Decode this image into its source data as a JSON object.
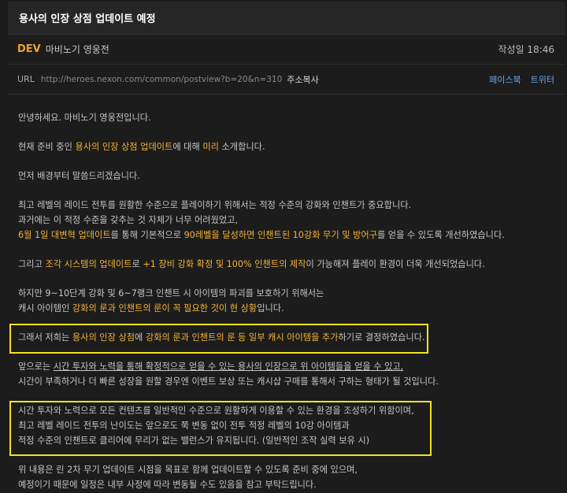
{
  "post": {
    "title": "용사의 인장 상점 업데이트 예정",
    "author_tag": "DEV",
    "author_name": "마비노기 영웅전",
    "date": "작성일 18:46",
    "url_label": "URL",
    "url": "http://heroes.nexon.com/common/postview?b=20&n=310",
    "copy_label": "주소복사",
    "share_facebook": "페이스북",
    "share_twitter": "트위터"
  },
  "body": {
    "p1": "안녕하세요. 마비노기 영웅전입니다.",
    "p2": {
      "a": "현재 준비 중인 ",
      "b": "용사의 인장 상점 업데이트",
      "c": "에 대해 ",
      "d": "미리",
      "e": " 소개합니다."
    },
    "p3": "먼저 배경부터 말씀드리겠습니다.",
    "p4_l1": "최고 레벨의 레이드 전투를 원활한 수준으로 플레이하기 위해서는 적정 수준의 강화와 인챈트가 중요합니다.",
    "p4_l2": "과거에는 이 적정 수준을 갖추는 것 자체가 너무 어려웠었고,",
    "p4_l3": {
      "a": "6월 1일 대변혁 업데이트",
      "b": "를 통해 기본적으로 ",
      "c": "90레벨을 달성하면 인챈트된 10강화 무기 및 방어구",
      "d": "를 얻을 수 있도록 개선하였습니다."
    },
    "p5": {
      "a": "그리고 ",
      "b": "조각 시스템의 업데이트",
      "c": "로 ",
      "d": "+1 장비 강화 확정 및 100% 인챈트의 제작",
      "e": "이 가능해져 플레이 환경이 더욱 개선되었습니다."
    },
    "p6_l1": "하지만 9~10단계 강화 및 6~7랭크 인챈트 시 아이템의 파괴를 보호하기 위해서는",
    "p6_l2": {
      "a": "캐시 아이템인 ",
      "b": "강화의 룬과 인챈트의 룬이 꼭 필요한 것이 현 상황",
      "c": "입니다."
    },
    "p7": {
      "a": "그래서 저희는 ",
      "b": "용사의 인장 상점",
      "c": "에 ",
      "d": "강화의 룬과 인챈트의 룬 등 일부 캐시 아이템을 추가",
      "e": "하기로 결정하였습니다."
    },
    "p8_l1": {
      "a": "앞으로는 ",
      "b": "시간 투자와 노력을 통해 확정적으로 얻을 수 있는 용사의 인장으로 위 아이템들을 얻을 수 있고,",
      "c": ""
    },
    "p8_l2": "시간이 부족하거나 더 빠른 성장을 원할 경우엔 이벤트 보상 또는 캐시샵 구매를 통해서 구하는 형태가 될 것입니다.",
    "p9_l1": "시간 투자와 노력으로 모든 컨텐츠를 일반적인 수준으로 원활하게 이용할 수 있는 환경을 조성하기 위함이며,",
    "p9_l2": "최고 레벨 레이드 전투의 난이도는 앞으로도 쭉 변동 없이 전투 적정 레벨의 10강 아이템과",
    "p9_l3": "적정 수준의 인챈트로 클리어에 무리가 없는 밸런스가 유지됩니다. (일반적인 조작 실력 보유 시)",
    "p10_l1": "위 내용은 린 2차 무기 업데이트 시점을 목표로 함께 업데이트할 수 있도록 준비 중에 있으며,",
    "p10_l2": "예정이기 때문에 일정은 내부 사정에 따라 변동될 수도 있음을 참고 부탁드립니다."
  },
  "colors": {
    "highlight_text": "#f3b23a",
    "annotation_box": "#f2e41c",
    "link": "#6aa6e8",
    "dev_tag": "#f0a030"
  }
}
